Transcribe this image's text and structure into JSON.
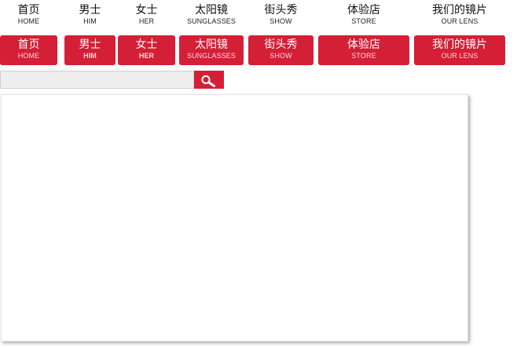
{
  "nav_top": {
    "items": [
      {
        "cn": "首页",
        "en": "HOME"
      },
      {
        "cn": "男士",
        "en": "HIM"
      },
      {
        "cn": "女士",
        "en": "HER"
      },
      {
        "cn": "太阳镜",
        "en": "SUNGLASSES"
      },
      {
        "cn": "街头秀",
        "en": "SHOW"
      },
      {
        "cn": "体验店",
        "en": "STORE"
      },
      {
        "cn": "我们的镜片",
        "en": "OUR LENS"
      }
    ]
  },
  "nav_bottom": {
    "items": [
      {
        "cn": "首页",
        "en": "HOME"
      },
      {
        "cn": "男士",
        "en": "HIM"
      },
      {
        "cn": "女士",
        "en": "HER"
      },
      {
        "cn": "太阳镜",
        "en": "SUNGLASSES"
      },
      {
        "cn": "街头秀",
        "en": "SHOW"
      },
      {
        "cn": "体验店",
        "en": "STORE"
      },
      {
        "cn": "我们的镜片",
        "en": "OUR LENS"
      }
    ]
  },
  "search": {
    "value": "",
    "placeholder": "",
    "button_icon": "magnifier-icon"
  },
  "colors": {
    "accent": "#d41f36",
    "input_bg": "#eeeeee"
  }
}
